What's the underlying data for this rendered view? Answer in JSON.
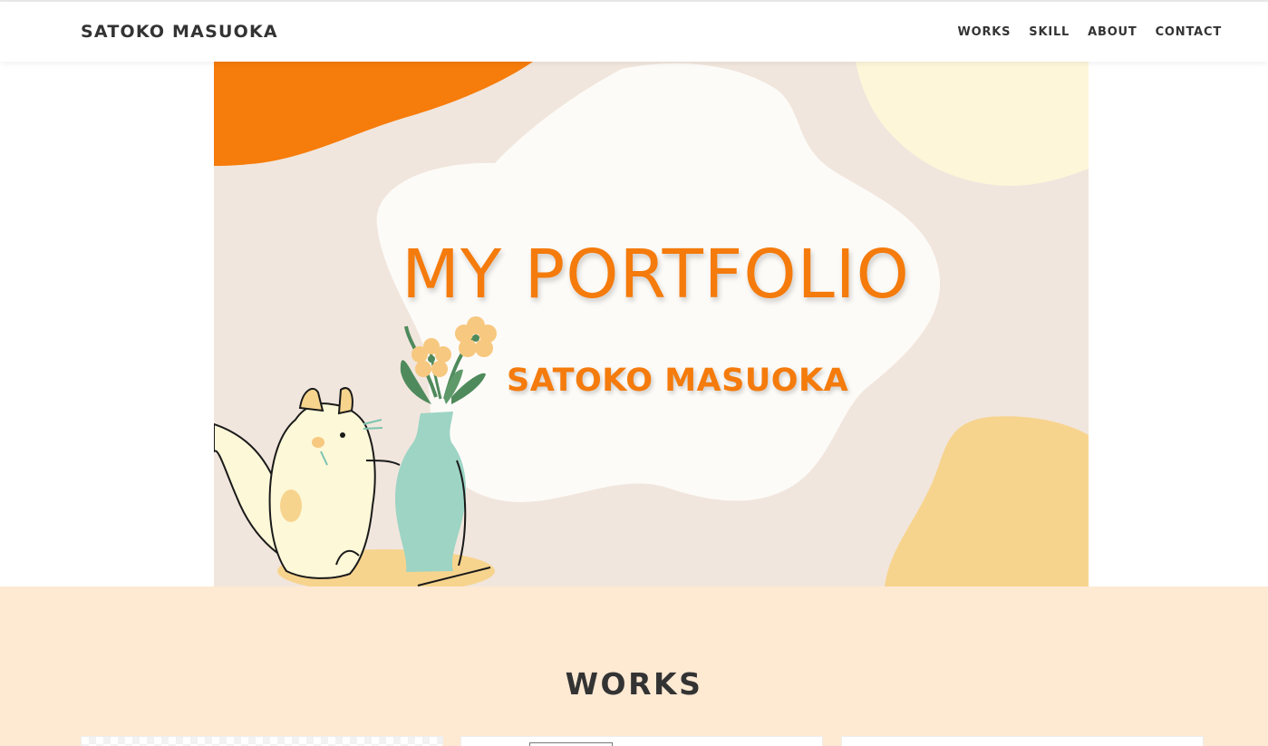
{
  "header": {
    "brand": "SATOKO MASUOKA",
    "nav": [
      "WORKS",
      "SKILL",
      "ABOUT",
      "CONTACT"
    ]
  },
  "hero": {
    "title": "MY PORTFOLIO",
    "subtitle": "SATOKO MASUOKA",
    "illustration_icons": [
      "cat-icon",
      "flower-vase-icon"
    ]
  },
  "works": {
    "title": "WORKS"
  },
  "colors": {
    "accent_orange": "#f47b0c",
    "hero_background": "#f1e6dd",
    "works_background": "#fee9d3",
    "vase_mint": "#9dd4c4",
    "blob_yellow": "#f7d48e"
  }
}
